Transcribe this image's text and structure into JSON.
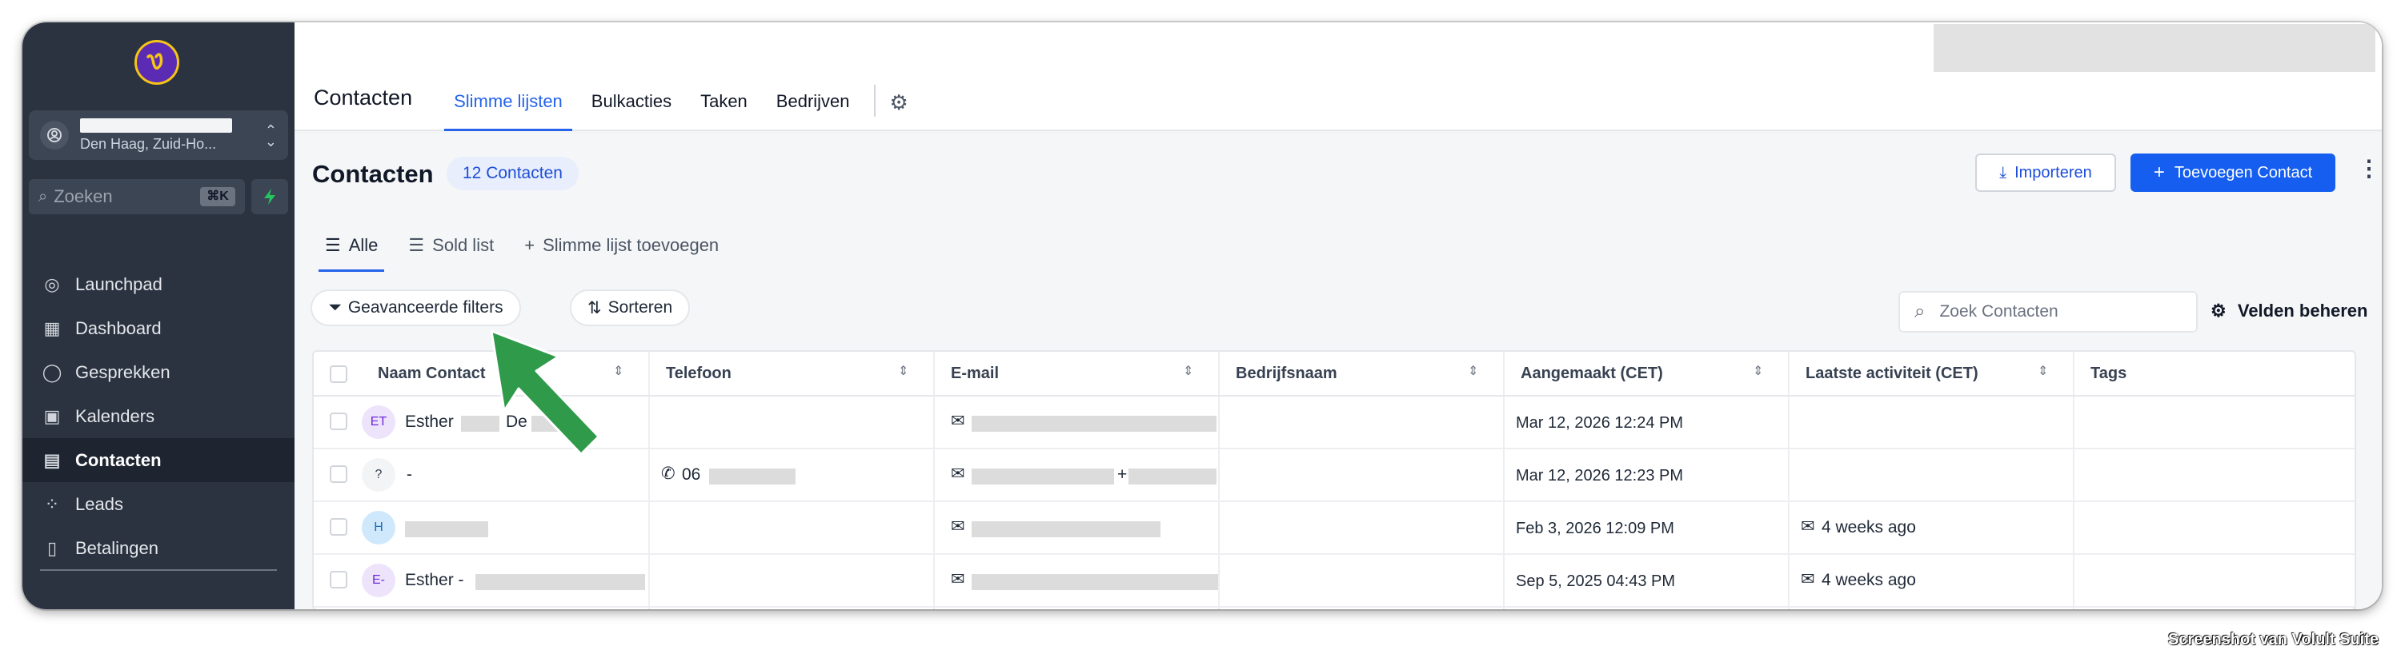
{
  "sidebar": {
    "logo_letter": "ᵿ",
    "account": {
      "location": "Den Haag, Zuid-Ho..."
    },
    "search": {
      "placeholder": "Zoeken",
      "shortcut": "⌘K"
    },
    "items": [
      {
        "label": "Launchpad",
        "icon": "rocket-icon",
        "glyph": "◎"
      },
      {
        "label": "Dashboard",
        "icon": "dashboard-icon",
        "glyph": "▦"
      },
      {
        "label": "Gesprekken",
        "icon": "chat-icon",
        "glyph": "◯"
      },
      {
        "label": "Kalenders",
        "icon": "calendar-icon",
        "glyph": "▣"
      },
      {
        "label": "Contacten",
        "icon": "contacts-icon",
        "glyph": "▤",
        "active": true
      },
      {
        "label": "Leads",
        "icon": "leads-icon",
        "glyph": "⁘"
      },
      {
        "label": "Betalingen",
        "icon": "payments-icon",
        "glyph": "▯"
      }
    ]
  },
  "topnav": {
    "title": "Contacten",
    "tabs": [
      "Slimme lijsten",
      "Bulkacties",
      "Taken",
      "Bedrijven"
    ],
    "active_tab": "Slimme lijsten"
  },
  "page": {
    "title": "Contacten",
    "count_badge": "12 Contacten",
    "import_label": "Importeren",
    "add_label": "Toevoegen Contact",
    "subtabs": [
      "Alle",
      "Sold list",
      "Slimme lijst toevoegen"
    ],
    "filters_label": "Geavanceerde filters",
    "sort_label": "Sorteren",
    "search_placeholder": "Zoek Contacten",
    "fields_label": "Velden beheren"
  },
  "table": {
    "columns": [
      "Naam Contact",
      "Telefoon",
      "E-mail",
      "Bedrijfsnaam",
      "Aangemaakt (CET)",
      "Laatste activiteit (CET)",
      "Tags"
    ],
    "rows": [
      {
        "initials": "ET",
        "name": "Esther",
        "name_suffix": "De",
        "phone": "",
        "created": "Mar 12, 2026 12:24 PM",
        "activity": ""
      },
      {
        "initials": "?",
        "name": "-",
        "name_suffix": "",
        "phone": "06",
        "created": "Mar 12, 2026 12:23 PM",
        "activity": ""
      },
      {
        "initials": "H",
        "name": "",
        "name_suffix": "",
        "phone": "",
        "created": "Feb 3, 2026 12:09 PM",
        "activity": "4 weeks ago"
      },
      {
        "initials": "E-",
        "name": "Esther -",
        "name_suffix": "",
        "phone": "",
        "created": "Sep 5, 2025 04:43 PM",
        "activity": "4 weeks ago"
      }
    ]
  },
  "colors": {
    "sidebar_bg": "#2b3340",
    "primary": "#155eef",
    "accent_arrow": "#2e9a4a"
  },
  "watermark": "Screenshot van Volult Suite"
}
